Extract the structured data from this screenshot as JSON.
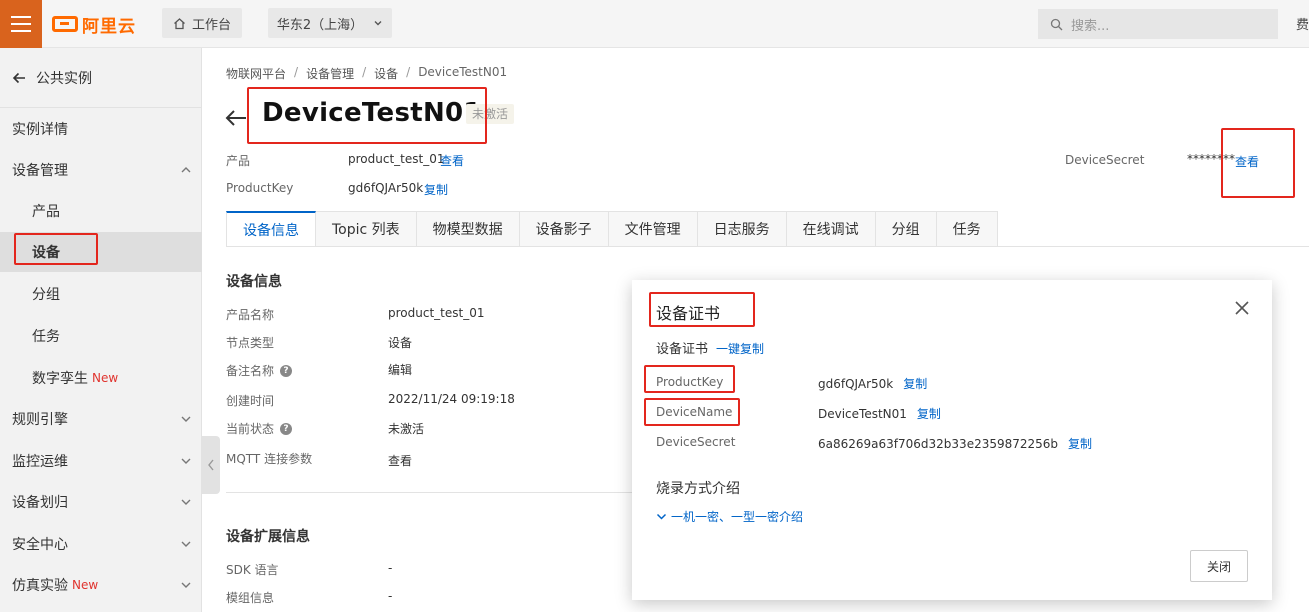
{
  "topbar": {
    "logo_text": "阿里云",
    "workbench_label": "工作台",
    "region_label": "华东2（上海）",
    "search_placeholder": "搜索...",
    "clipped_text": "费"
  },
  "sidebar": {
    "back_label": "公共实例",
    "items": [
      {
        "label": "实例详情"
      },
      {
        "label": "设备管理"
      },
      {
        "label": "产品"
      },
      {
        "label": "设备"
      },
      {
        "label": "分组"
      },
      {
        "label": "任务"
      },
      {
        "label": "数字孪生",
        "badge": "New"
      },
      {
        "label": "规则引擎"
      },
      {
        "label": "监控运维"
      },
      {
        "label": "设备划归"
      },
      {
        "label": "安全中心"
      },
      {
        "label": "仿真实验",
        "badge": "New"
      }
    ]
  },
  "breadcrumb": [
    "物联网平台",
    "设备管理",
    "设备",
    "DeviceTestN01"
  ],
  "device": {
    "name": "DeviceTestN01",
    "status": "未激活",
    "product_label": "产品",
    "product_value": "product_test_01",
    "view_link": "查看",
    "productkey_label": "ProductKey",
    "productkey_value": "gd6fQJAr50k",
    "copy_link": "复制",
    "secret_label": "DeviceSecret",
    "secret_value": "********",
    "secret_view": "查看"
  },
  "tabs": [
    "设备信息",
    "Topic 列表",
    "物模型数据",
    "设备影子",
    "文件管理",
    "日志服务",
    "在线调试",
    "分组",
    "任务"
  ],
  "info": {
    "title": "设备信息",
    "rows": [
      {
        "label": "产品名称",
        "value": "product_test_01"
      },
      {
        "label": "节点类型",
        "value": "设备"
      },
      {
        "label": "备注名称",
        "value": "编辑"
      },
      {
        "label": "创建时间",
        "value": "2022/11/24 09:19:18"
      },
      {
        "label": "当前状态",
        "value": "未激活"
      },
      {
        "label": "MQTT 连接参数",
        "value": "查看"
      }
    ]
  },
  "ext": {
    "title": "设备扩展信息",
    "rows": [
      {
        "label": "SDK 语言",
        "value": "-"
      },
      {
        "label": "模组信息",
        "value": "-"
      }
    ]
  },
  "modal": {
    "title": "设备证书",
    "subtitle": "设备证书",
    "copy_all": "一键复制",
    "fields": [
      {
        "label": "ProductKey",
        "value": "gd6fQJAr50k",
        "copy": "复制"
      },
      {
        "label": "DeviceName",
        "value": "DeviceTestN01",
        "copy": "复制"
      },
      {
        "label": "DeviceSecret",
        "value": "6a86269a63f706d32b33e2359872256b",
        "copy": "复制"
      }
    ],
    "burn_title": "烧录方式介绍",
    "burn_link": "一机一密、一型一密介绍",
    "close_label": "关闭"
  },
  "colors": {
    "accent": "#0064c8",
    "brand": "#ff6a00",
    "annotation": "#e3261d",
    "new_badge": "#e0342f"
  }
}
